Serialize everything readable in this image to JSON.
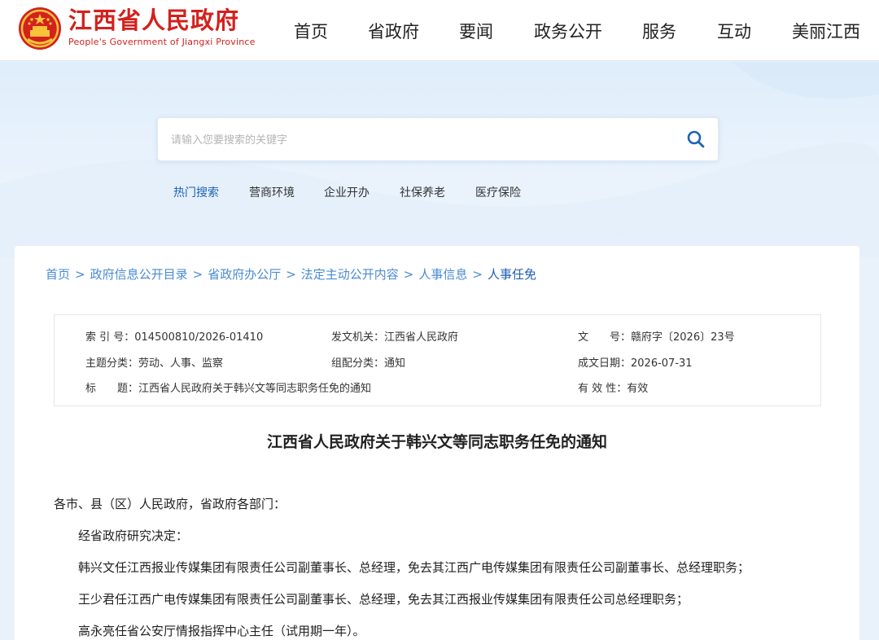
{
  "header": {
    "site_title": "江西省人民政府",
    "site_subtitle": "People's Government of Jiangxi Province",
    "brand_color": "#d3211d",
    "nav": [
      {
        "label": "首页"
      },
      {
        "label": "省政府"
      },
      {
        "label": "要闻"
      },
      {
        "label": "政务公开"
      },
      {
        "label": "服务"
      },
      {
        "label": "互动"
      },
      {
        "label": "美丽江西"
      }
    ]
  },
  "search": {
    "placeholder": "请输入您要搜索的关键字",
    "value": "",
    "icon": "search-icon",
    "hot": [
      {
        "label": "热门搜索"
      },
      {
        "label": "营商环境"
      },
      {
        "label": "企业开办"
      },
      {
        "label": "社保养老"
      },
      {
        "label": "医疗保险"
      }
    ]
  },
  "breadcrumb": {
    "separator": ">",
    "items": [
      "首页",
      "政府信息公开目录",
      "省政府办公厅",
      "法定主动公开内容",
      "人事信息",
      "人事任免"
    ]
  },
  "meta": {
    "index_label": "索 引 号：",
    "index_value": "014500810/2026-01410",
    "issuer_label": "发文机关：",
    "issuer_value": "江西省人民政府",
    "docno_label": "文　　号：",
    "docno_value": "赣府字〔2026〕23号",
    "topic_label": "主题分类：",
    "topic_value": "劳动、人事、监察",
    "category_label": "组配分类：",
    "category_value": "通知",
    "date_label": "成文日期：",
    "date_value": "2026-07-31",
    "title_label": "标　　题：",
    "title_value": "江西省人民政府关于韩兴文等同志职务任免的通知",
    "validity_label": "有 效 性：",
    "validity_value": "有效"
  },
  "document": {
    "title": "江西省人民政府关于韩兴文等同志职务任免的通知",
    "salutation": "各市、县（区）人民政府，省政府各部门：",
    "paragraphs": [
      "经省政府研究决定：",
      "韩兴文任江西报业传媒集团有限责任公司副董事长、总经理，免去其江西广电传媒集团有限责任公司副董事长、总经理职务；",
      "王少君任江西广电传媒集团有限责任公司副董事长、总经理，免去其江西报业传媒集团有限责任公司总经理职务；",
      "高永亮任省公安厅情报指挥中心主任（试用期一年）。"
    ]
  }
}
